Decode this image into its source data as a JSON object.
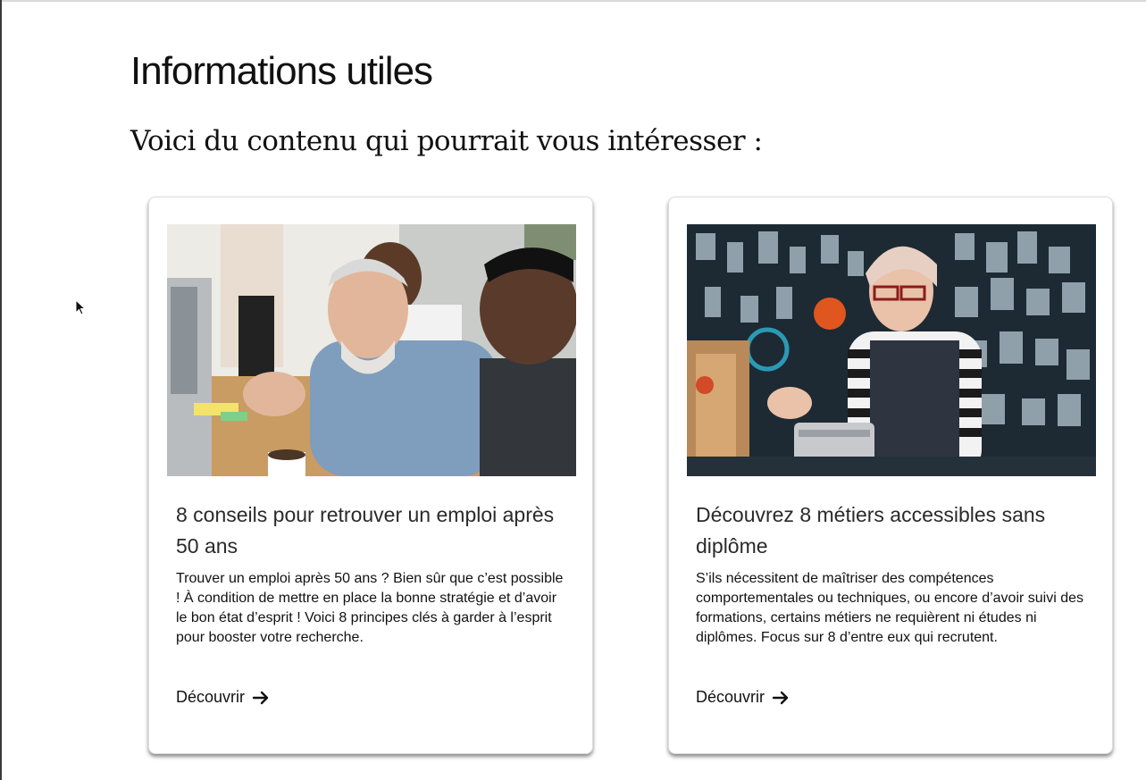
{
  "page": {
    "title": "Informations utiles",
    "subtitle": "Voici du contenu qui pourrait vous intéresser :"
  },
  "cards": [
    {
      "title": "8 conseils pour retrouver un emploi après 50 ans",
      "description": "Trouver un emploi après 50 ans ? Bien sûr que c’est possible ! À condition de mettre en place la bonne stratégie et d’avoir le bon état d’esprit ! Voici 8 principes clés à garder à l’esprit pour booster votre recherche.",
      "link_label": "Découvrir",
      "link_icon": "arrow-right-icon",
      "image": "photo-senior-office-worker"
    },
    {
      "title": "Découvrez 8 métiers accessibles sans diplôme",
      "description": "S’ils nécessitent de maîtriser des compétences comportementales ou techniques, ou encore d’avoir suivi des formations, certains métiers ne requièrent ni études ni diplômes. Focus sur 8 d’entre eux qui recrutent.",
      "link_label": "Découvrir",
      "link_icon": "arrow-right-icon",
      "image": "photo-shop-cashier"
    }
  ]
}
